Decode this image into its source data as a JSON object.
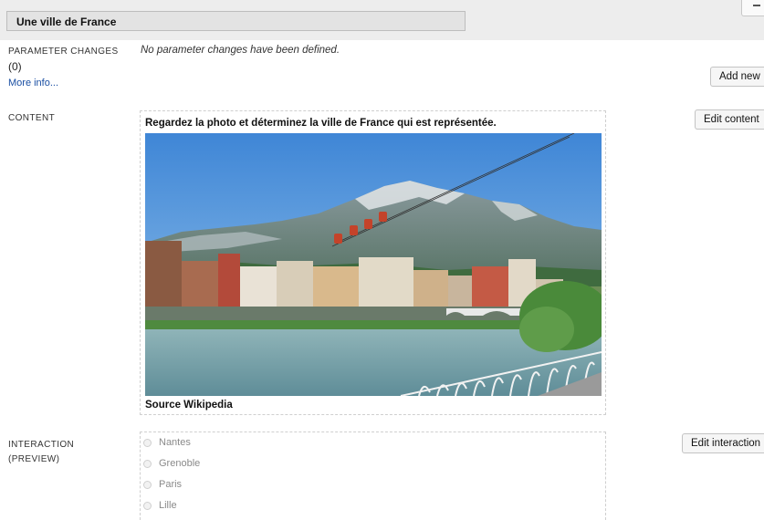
{
  "state": {
    "name": "Une ville de France"
  },
  "parameters": {
    "label": "PARAMETER CHANGES",
    "count": "(0)",
    "more_info": "More info...",
    "empty_text": "No parameter changes have been defined.",
    "add_button": "Add new"
  },
  "content": {
    "label": "CONTENT",
    "edit_button": "Edit content",
    "title": "Regardez la photo et déterminez la ville de France qui est représentée.",
    "caption": "Source Wikipedia",
    "image": "photo of a city with river, buildings, mountains and cable car gondolas"
  },
  "interaction": {
    "label": "INTERACTION",
    "sublabel": "(PREVIEW)",
    "edit_button": "Edit interaction",
    "choices": [
      "Nantes",
      "Grenoble",
      "Paris",
      "Lille"
    ]
  },
  "colors": {
    "link": "#1a4fa3",
    "header_band": "#ededed",
    "muted_choice": "#8a8a8a"
  }
}
